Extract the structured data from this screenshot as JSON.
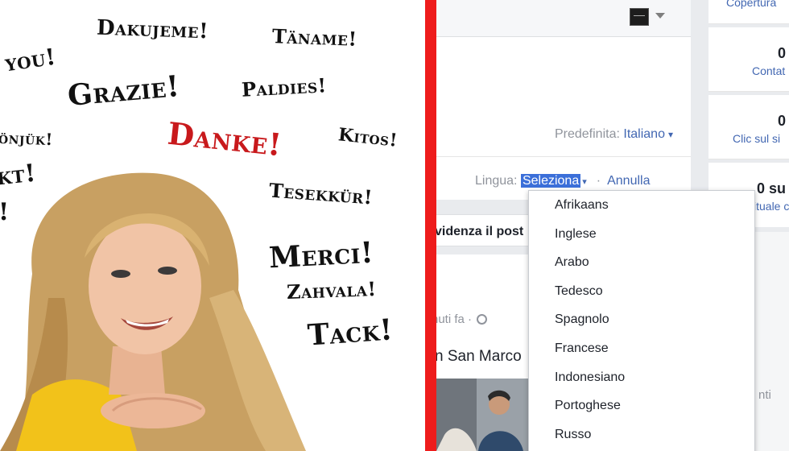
{
  "thank_you_words": {
    "dakujeme": "Dakujeme!",
    "taname": "Täname!",
    "you": "you!",
    "grazie": "Grazie!",
    "paldies": "Paldies!",
    "onjuk": "önjük!",
    "danke": "Danke!",
    "kitos": "Kitos!",
    "kt": "kt!",
    "tesekkur": "Tesekkür!",
    "excl": "!",
    "merci": "Merci!",
    "zahvala": "Zahvala!",
    "tack": "Tack!"
  },
  "colors": {
    "divider": "#ee1c1c",
    "danke": "#c8191c",
    "link": "#4267b2",
    "selection": "#3b6fd9"
  },
  "language_settings": {
    "default_label": "Predefinita:",
    "default_value": "Italiano",
    "lingua_label": "Lingua:",
    "select_value": "Seleziona",
    "cancel_label": "Annulla",
    "separator": "·"
  },
  "highlight_post_label": "videnza il post",
  "post": {
    "time_text": "nuti fa ·",
    "text": "n San Marco"
  },
  "side_panel": {
    "top_link": "Copertura",
    "contacts_count": "0",
    "contacts_label": "Contat",
    "clicks_count": "0",
    "clicks_label": "Clic sul si",
    "third_count": "0 su",
    "third_label": "ituale c",
    "bottom_text": "nti"
  },
  "language_dropdown": {
    "options": [
      "Afrikaans",
      "Inglese",
      "Arabo",
      "Tedesco",
      "Spagnolo",
      "Francese",
      "Indonesiano",
      "Portoghese",
      "Russo"
    ]
  }
}
